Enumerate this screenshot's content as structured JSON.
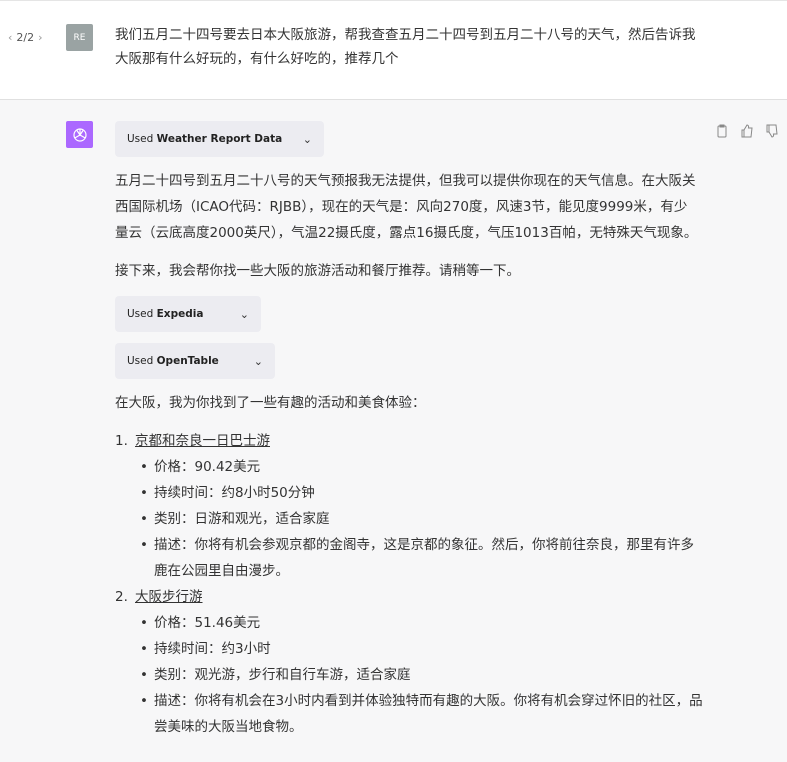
{
  "user": {
    "pager": "2/2",
    "avatar": "RE",
    "message": "我们五月二十四号要去日本大阪旅游，帮我查查五月二十四号到五月二十八号的天气，然后告诉我大阪那有什么好玩的，有什么好吃的，推荐几个"
  },
  "assistant": {
    "tools": [
      {
        "prefix": "Used",
        "name": "Weather Report Data"
      },
      {
        "prefix": "Used",
        "name": "Expedia"
      },
      {
        "prefix": "Used",
        "name": "OpenTable"
      }
    ],
    "p1": "五月二十四号到五月二十八号的天气预报我无法提供，但我可以提供你现在的天气信息。在大阪关西国际机场（ICAO代码：RJBB），现在的天气是：风向270度，风速3节，能见度9999米，有少量云（云底高度2000英尺），气温22摄氏度，露点16摄氏度，气压1013百帕，无特殊天气现象。",
    "p2": "接下来，我会帮你找一些大阪的旅游活动和餐厅推荐。请稍等一下。",
    "p3": "在大阪，我为你找到了一些有趣的活动和美食体验：",
    "items": [
      {
        "num": "1.",
        "title": "京都和奈良一日巴士游",
        "details": [
          "价格：90.42美元",
          "持续时间：约8小时50分钟",
          "类别：日游和观光，适合家庭",
          "描述：你将有机会参观京都的金阁寺，这是京都的象征。然后，你将前往奈良，那里有许多鹿在公园里自由漫步。"
        ]
      },
      {
        "num": "2.",
        "title": "大阪步行游",
        "details": [
          "价格：51.46美元",
          "持续时间：约3小时",
          "类别：观光游，步行和自行车游，适合家庭",
          "描述：你将有机会在3小时内看到并体验独特而有趣的大阪。你将有机会穿过怀旧的社区，品尝美味的大阪当地食物。"
        ]
      }
    ]
  }
}
